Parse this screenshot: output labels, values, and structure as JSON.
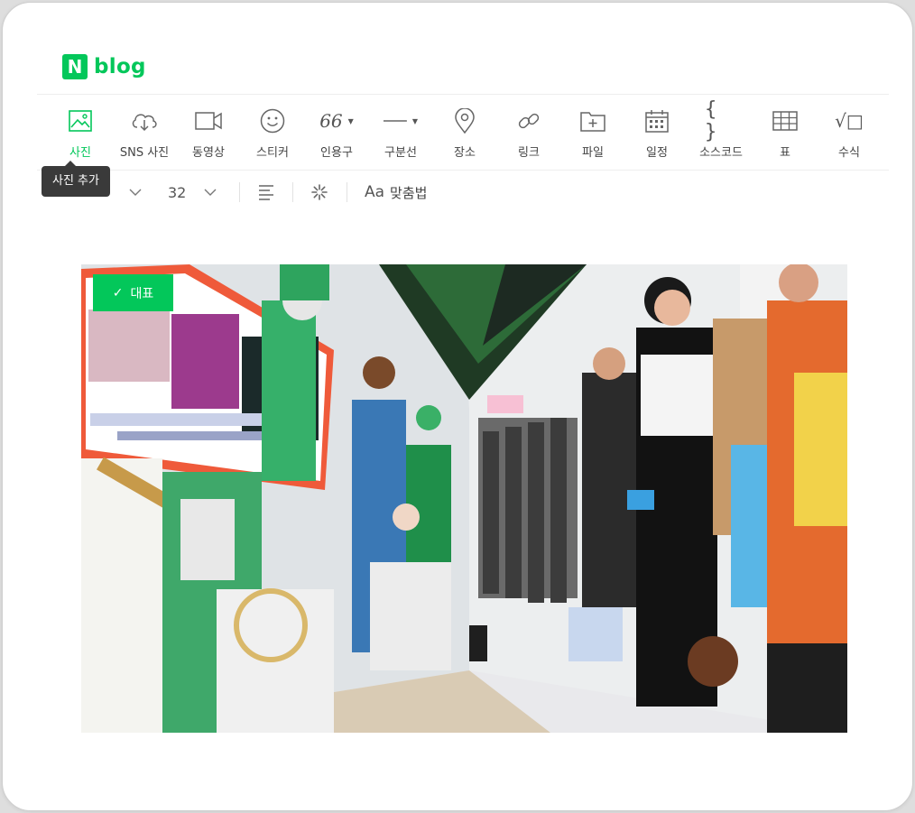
{
  "app": {
    "logo_letter": "N",
    "logo_text": "blog",
    "brand_color": "#03c75a"
  },
  "toolbar": {
    "items": [
      {
        "label": "사진",
        "icon": "image-icon",
        "active": true
      },
      {
        "label": "SNS 사진",
        "icon": "cloud-download-icon"
      },
      {
        "label": "동영상",
        "icon": "video-camera-icon"
      },
      {
        "label": "스티커",
        "icon": "smiley-icon"
      },
      {
        "label": "인용구",
        "icon": "quote-icon",
        "glyph": "66"
      },
      {
        "label": "구분선",
        "icon": "divider-line-icon"
      },
      {
        "label": "장소",
        "icon": "location-pin-icon"
      },
      {
        "label": "링크",
        "icon": "link-icon"
      },
      {
        "label": "파일",
        "icon": "folder-add-icon"
      },
      {
        "label": "일정",
        "icon": "calendar-icon"
      },
      {
        "label": "소스코드",
        "icon": "code-braces-icon",
        "glyph": "{ }"
      },
      {
        "label": "표",
        "icon": "table-grid-icon"
      },
      {
        "label": "수식",
        "icon": "formula-icon",
        "glyph": "√□"
      }
    ]
  },
  "tooltip": {
    "text": "사진 추가"
  },
  "format_bar": {
    "font_size": "32",
    "spellcheck_label": "맞춤법",
    "spellcheck_glyph": "Aa"
  },
  "photo": {
    "badge_label": "대표",
    "badge_check": "✓"
  }
}
